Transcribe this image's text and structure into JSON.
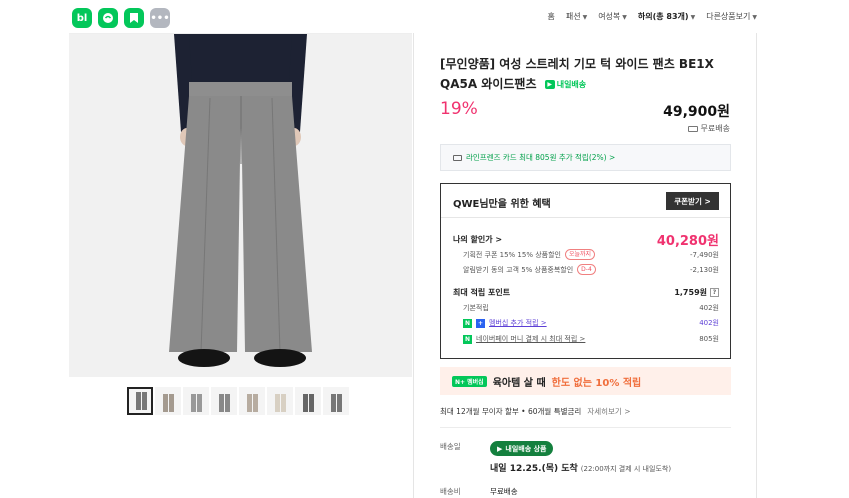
{
  "header": {
    "app_icons": [
      {
        "name": "naver-blog-icon",
        "glyph": "bl",
        "color": "#03c75a"
      },
      {
        "name": "naver-cafe-icon",
        "glyph": "☕",
        "color": "#03c75a"
      },
      {
        "name": "bookmark-icon",
        "glyph": "⚑",
        "color": "#03c75a"
      },
      {
        "name": "more-icon",
        "glyph": "•••",
        "color": "#b3b7bf"
      }
    ],
    "breadcrumb": [
      "홈",
      "패션",
      "여성복",
      "하의(총 83개)",
      "다른상품보기"
    ]
  },
  "product": {
    "title_part1": "[무인양품] 여성 스트레치 기모 턱 와이드 팬츠 BE1X",
    "title_part2": "QA5A 와이드팬츠",
    "fast_delivery_tag": "내일배송",
    "discount_rate": "19%",
    "price": "49,900원",
    "shipping": "무료배송",
    "card_benefit": "라인프렌즈 카드 최대 805원 추가 적립(2%) >"
  },
  "benefit": {
    "heading": "QWE님만을 위한 혜택",
    "coupon_button": "쿠폰받기 >",
    "my_price_label": "나의 할인가 >",
    "my_price_value": "40,280원",
    "sub1_label": "기획전 쿠폰 15% 15% 상품할인",
    "sub1_pill": "오늘까지",
    "sub1_value": "-7,490원",
    "sub2_label": "알림받기 동의 고객 5% 상품중복할인",
    "sub2_pill": "D-4",
    "sub2_value": "-2,130원",
    "points_label": "최대 적립 포인트",
    "points_value": "1,759원",
    "points_help": "?",
    "base_label": "기본적립",
    "base_value": "402원",
    "member_label": "멤버십 추가 적립 >",
    "member_value": "402원",
    "npay_label": "네이버페이 머니 결제 시 최대 적립 >",
    "npay_value": "805원"
  },
  "promo": {
    "badge": "N+ 멤버십",
    "text1": "육아템 살 때",
    "text2": "한도 없는 10% 적립"
  },
  "installment": {
    "text": "최대 12개월 무이자 할부 • 60개월 특별금리",
    "more": "자세히보기 >"
  },
  "delivery": {
    "label": "배송일",
    "badge": "내일배송 상품",
    "date": "내일 12.25.(목) 도착",
    "note": "(22:00까지 결제 시 내일도착)",
    "fee_label": "배송비",
    "fee_value": "무료배송"
  },
  "colors": {
    "accent_green": "#03c75a",
    "discount_pink": "#f0326f",
    "promo_orange": "#f06e3c"
  }
}
